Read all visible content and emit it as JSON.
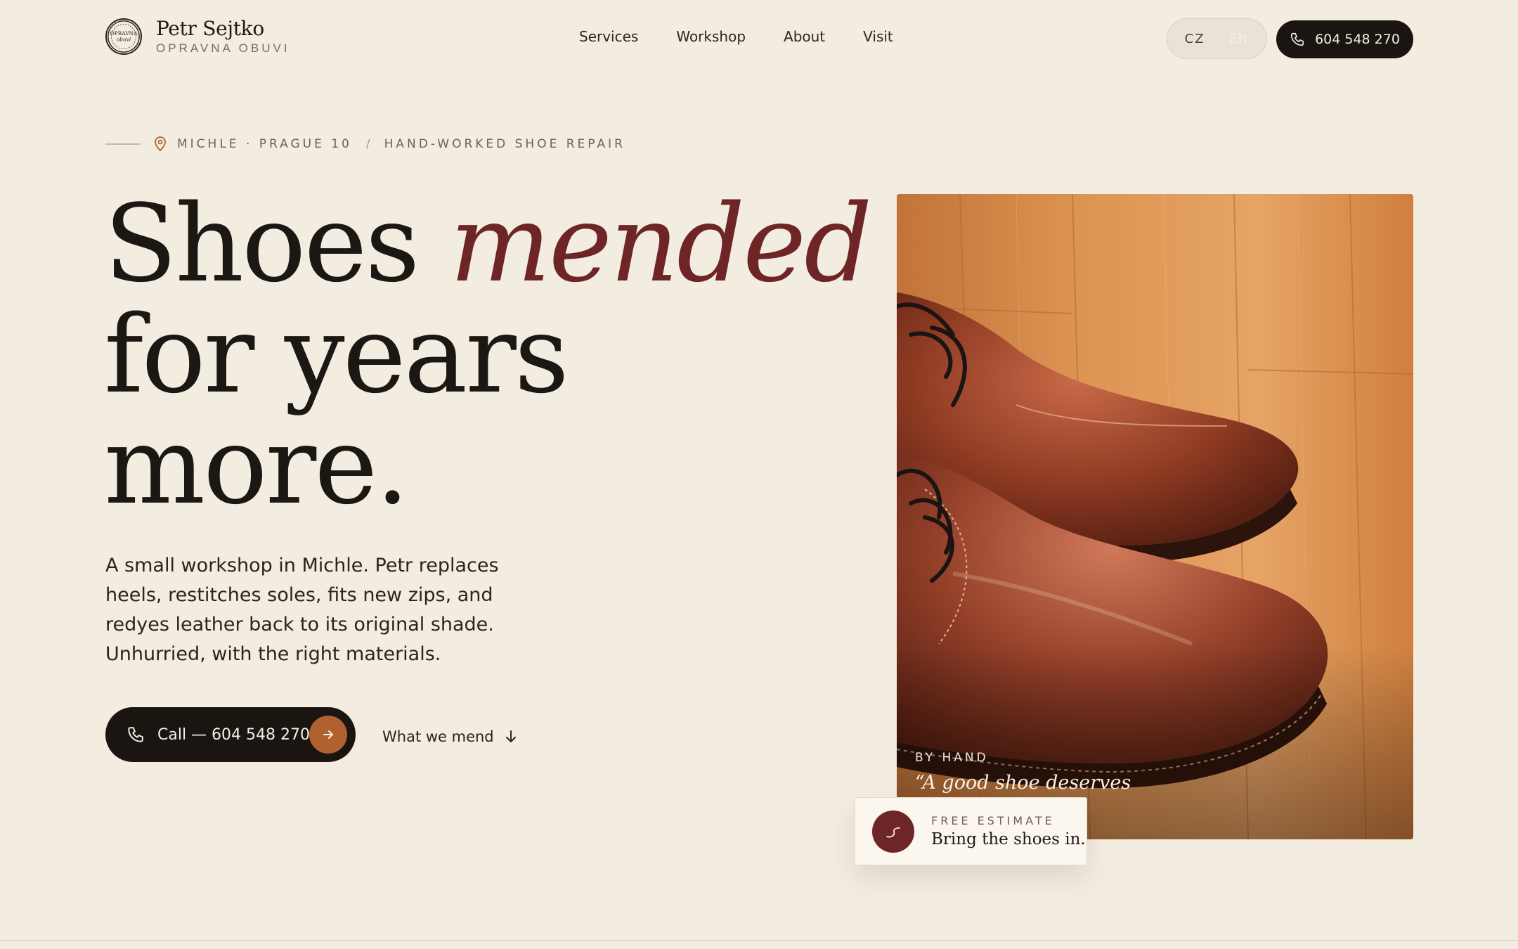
{
  "brand": {
    "name": "Petr Sejtko",
    "subtitle": "OPRAVNA OBUVI",
    "badge_line1": "OPRAVNA",
    "badge_line2": "obuvi"
  },
  "nav": {
    "items": [
      {
        "label": "Services"
      },
      {
        "label": "Workshop"
      },
      {
        "label": "About"
      },
      {
        "label": "Visit"
      }
    ]
  },
  "language": {
    "options": [
      "CZ",
      "EN"
    ],
    "active": "CZ"
  },
  "header_phone": {
    "label": "604 548 270"
  },
  "eyebrow": {
    "location": "MICHLE · PRAGUE 10",
    "separator": "/",
    "tagline": "HAND-WORKED SHOE REPAIR"
  },
  "hero": {
    "headline_part1": "Shoes",
    "headline_accent": "mended",
    "headline_line2": "for years",
    "headline_line3": "more.",
    "lede": "A small workshop in Michle. Petr replaces heels, restitches soles, fits new zips, and redyes leather back to its original shade. Unhurried, with the right materials.",
    "cta_label": "Call — 604 548 270",
    "secondary_label": "What we mend"
  },
  "photo": {
    "caption_label": "BY HAND",
    "caption_quote": "“A good shoe deserves"
  },
  "estimate": {
    "label": "FREE ESTIMATE",
    "text": "Bring the shoes in."
  },
  "colors": {
    "background": "#f3ece1",
    "ink": "#1b1712",
    "accent_burgundy": "#6e2526",
    "accent_copper": "#b0612f"
  },
  "icons": [
    "location-pin-icon",
    "phone-icon",
    "arrow-right-icon",
    "arrow-down-icon",
    "stitch-icon"
  ]
}
